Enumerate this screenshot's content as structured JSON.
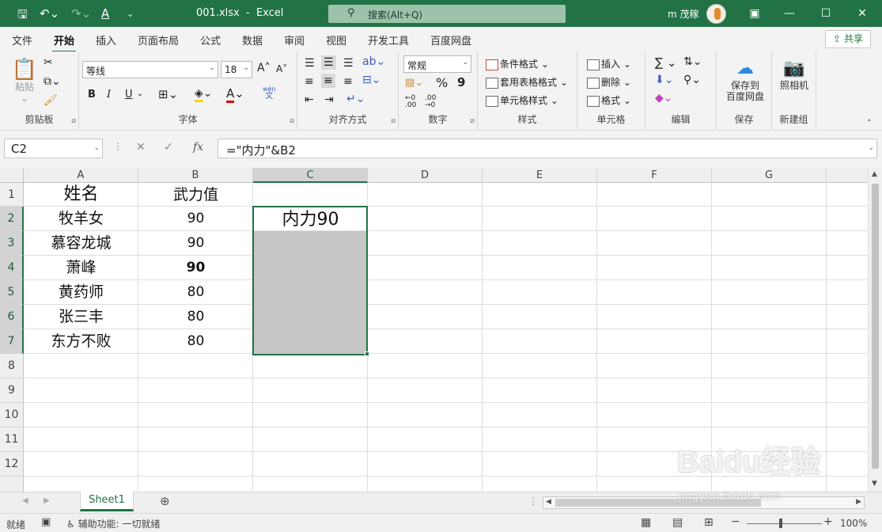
{
  "titlebar": {
    "filename": "001.xlsx",
    "separator": "-",
    "app": "Excel",
    "search_placeholder": "搜索(Alt+Q)",
    "user": "m 茂稼",
    "accent": "#217346"
  },
  "tabs": [
    "文件",
    "开始",
    "插入",
    "页面布局",
    "公式",
    "数据",
    "审阅",
    "视图",
    "开发工具",
    "百度网盘"
  ],
  "active_tab": "开始",
  "share_label": "共享",
  "ribbon": {
    "clipboard": {
      "paste": "粘贴",
      "label": "剪贴板"
    },
    "font": {
      "name": "等线",
      "size": "18",
      "bold": "B",
      "italic": "I",
      "underline": "U",
      "phonetic": "wén",
      "phonetic2": "文",
      "grow": "A",
      "shrink": "A",
      "label": "字体"
    },
    "alignment": {
      "label": "对齐方式"
    },
    "number": {
      "format": "常规",
      "percent": "%",
      "comma": "9",
      "label": "数字"
    },
    "styles": {
      "conditional": "条件格式",
      "table": "套用表格格式",
      "cell": "单元格样式",
      "label": "样式"
    },
    "cells": {
      "insert": "插入",
      "delete": "删除",
      "format": "格式",
      "label": "单元格"
    },
    "editing": {
      "label": "编辑"
    },
    "save": {
      "line1": "保存到",
      "line2": "百度网盘",
      "label": "保存"
    },
    "camera": {
      "name": "照相机",
      "label": "新建组"
    }
  },
  "formula_bar": {
    "name_box": "C2",
    "formula": "=\"内力\"&B2",
    "fx": "fx"
  },
  "columns": [
    "A",
    "B",
    "C",
    "D",
    "E",
    "F",
    "G"
  ],
  "selected_column": "C",
  "rows": [
    "1",
    "2",
    "3",
    "4",
    "5",
    "6",
    "7",
    "8",
    "9",
    "10",
    "11",
    "12"
  ],
  "cells": {
    "A1": "姓名",
    "B1": "武力值",
    "A2": "牧羊女",
    "B2": "90",
    "C2": "内力90",
    "A3": "慕容龙城",
    "B3": "90",
    "A4": "萧峰",
    "B4": "90",
    "A5": "黄药师",
    "B5": "80",
    "A6": "张三丰",
    "B6": "80",
    "A7": "东方不败",
    "B7": "80"
  },
  "sheet_tab": "Sheet1",
  "status": {
    "ready": "就绪",
    "accessibility": "辅助功能: 一切就绪",
    "zoom": "100%"
  },
  "watermark": {
    "text": "Baidu经验",
    "sub": "jingyan.baidu.com"
  }
}
